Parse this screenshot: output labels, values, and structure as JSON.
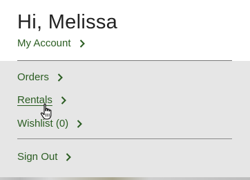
{
  "header": {
    "greeting": "Hi, Melissa",
    "my_account_label": "My Account"
  },
  "menu": {
    "orders_label": "Orders",
    "rentals_label": "Rentals",
    "wishlist_label": "Wishlist (0)",
    "signout_label": "Sign Out"
  },
  "colors": {
    "link": "#2b5d22",
    "menu_background": "#e6e6e6",
    "divider": "#7a7a7a"
  },
  "icons": {
    "chevron": "chevron-right-icon",
    "cursor": "hand-pointer-cursor-icon"
  },
  "state": {
    "hovered_item": "Rentals"
  }
}
